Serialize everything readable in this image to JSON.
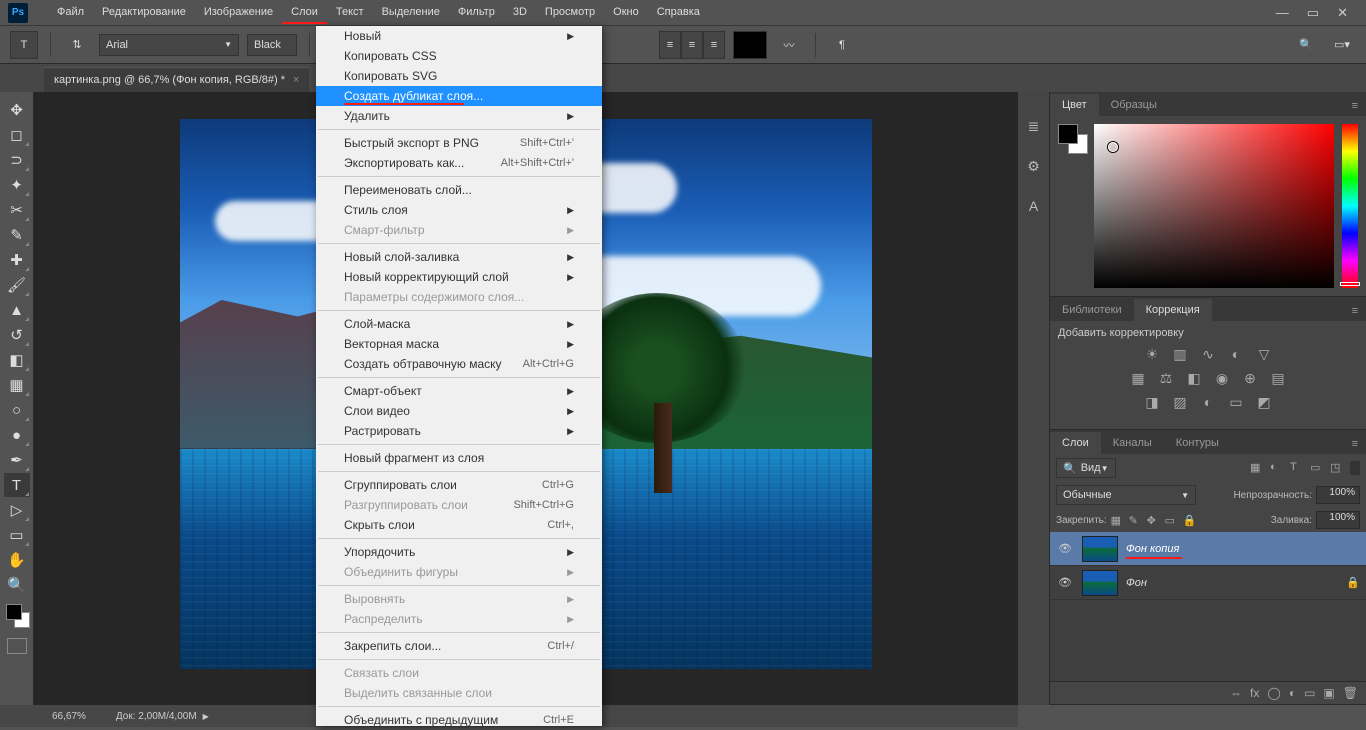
{
  "app": {
    "logo": "Ps"
  },
  "menubar": [
    "Файл",
    "Редактирование",
    "Изображение",
    "Слои",
    "Текст",
    "Выделение",
    "Фильтр",
    "3D",
    "Просмотр",
    "Окно",
    "Справка"
  ],
  "menubar_highlight_index": 3,
  "options": {
    "font": "Arial",
    "color_label": "Black"
  },
  "document_tab": "картинка.png @ 66,7% (Фон копия, RGB/8#) *",
  "dropdown_menu": [
    {
      "label": "Новый",
      "arrow": true
    },
    {
      "label": "Копировать CSS"
    },
    {
      "label": "Копировать SVG"
    },
    {
      "label": "Создать дубликат слоя...",
      "highlighted": true
    },
    {
      "label": "Удалить",
      "arrow": true
    },
    {
      "sep": true
    },
    {
      "label": "Быстрый экспорт в PNG",
      "shortcut": "Shift+Ctrl+'"
    },
    {
      "label": "Экспортировать как...",
      "shortcut": "Alt+Shift+Ctrl+'"
    },
    {
      "sep": true
    },
    {
      "label": "Переименовать слой..."
    },
    {
      "label": "Стиль слоя",
      "arrow": true
    },
    {
      "label": "Смарт-фильтр",
      "arrow": true,
      "disabled": true
    },
    {
      "sep": true
    },
    {
      "label": "Новый слой-заливка",
      "arrow": true
    },
    {
      "label": "Новый корректирующий слой",
      "arrow": true
    },
    {
      "label": "Параметры содержимого слоя...",
      "disabled": true
    },
    {
      "sep": true
    },
    {
      "label": "Слой-маска",
      "arrow": true
    },
    {
      "label": "Векторная маска",
      "arrow": true
    },
    {
      "label": "Создать обтравочную маску",
      "shortcut": "Alt+Ctrl+G"
    },
    {
      "sep": true
    },
    {
      "label": "Смарт-объект",
      "arrow": true
    },
    {
      "label": "Слои видео",
      "arrow": true
    },
    {
      "label": "Растрировать",
      "arrow": true
    },
    {
      "sep": true
    },
    {
      "label": "Новый фрагмент из слоя"
    },
    {
      "sep": true
    },
    {
      "label": "Сгруппировать слои",
      "shortcut": "Ctrl+G"
    },
    {
      "label": "Разгруппировать слои",
      "shortcut": "Shift+Ctrl+G",
      "disabled": true
    },
    {
      "label": "Скрыть слои",
      "shortcut": "Ctrl+,"
    },
    {
      "sep": true
    },
    {
      "label": "Упорядочить",
      "arrow": true
    },
    {
      "label": "Объединить фигуры",
      "arrow": true,
      "disabled": true
    },
    {
      "sep": true
    },
    {
      "label": "Выровнять",
      "arrow": true,
      "disabled": true
    },
    {
      "label": "Распределить",
      "arrow": true,
      "disabled": true
    },
    {
      "sep": true
    },
    {
      "label": "Закрепить слои...",
      "shortcut": "Ctrl+/"
    },
    {
      "sep": true
    },
    {
      "label": "Связать слои",
      "disabled": true
    },
    {
      "label": "Выделить связанные слои",
      "disabled": true
    },
    {
      "sep": true
    },
    {
      "label": "Объединить с предыдущим",
      "shortcut": "Ctrl+E"
    }
  ],
  "color_panel": {
    "tabs": [
      "Цвет",
      "Образцы"
    ],
    "active": 0
  },
  "corr_panel": {
    "tabs": [
      "Библиотеки",
      "Коррекция"
    ],
    "active": 1,
    "label": "Добавить корректировку"
  },
  "layers_panel": {
    "tabs": [
      "Слои",
      "Каналы",
      "Контуры"
    ],
    "active": 0,
    "filter_kind": "Вид",
    "blend_mode": "Обычные",
    "opacity_label": "Непрозрачность:",
    "opacity": "100%",
    "lock_label": "Закрепить:",
    "fill_label": "Заливка:",
    "fill": "100%",
    "layers": [
      {
        "name": "Фон копия",
        "selected": true,
        "underline": true
      },
      {
        "name": "Фон",
        "locked": true
      }
    ]
  },
  "status": {
    "zoom": "66,67%",
    "doc": "Док: 2,00M/4,00M"
  }
}
